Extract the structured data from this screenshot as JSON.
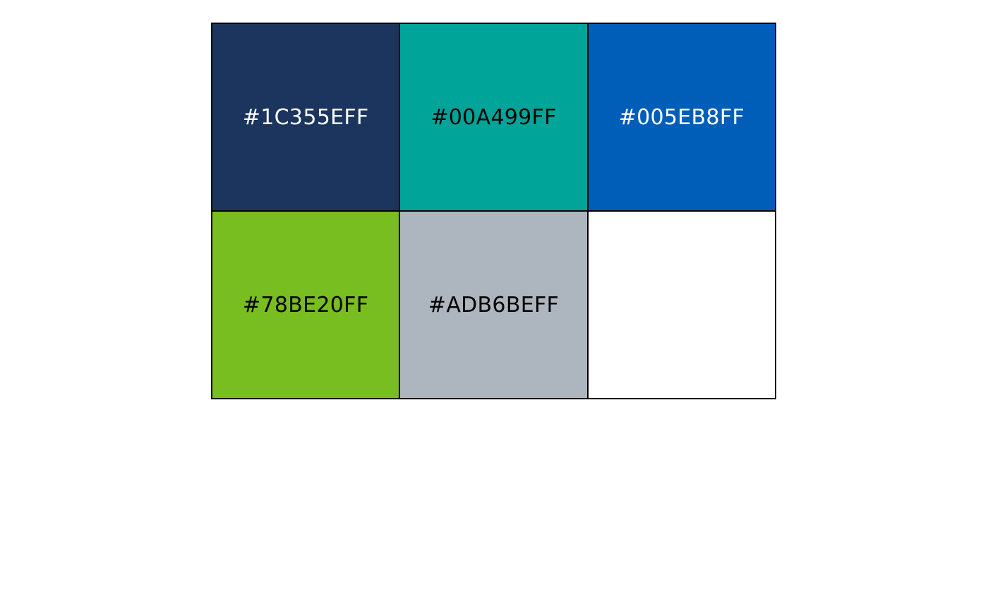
{
  "palette": {
    "swatches": [
      {
        "label": "#1C355EFF",
        "color": "#1C355E",
        "text_color": "#FFFFFF"
      },
      {
        "label": "#00A499FF",
        "color": "#00A499",
        "text_color": "#000000"
      },
      {
        "label": "#005EB8FF",
        "color": "#005EB8",
        "text_color": "#FFFFFF"
      },
      {
        "label": "#78BE20FF",
        "color": "#78BE20",
        "text_color": "#000000"
      },
      {
        "label": "#ADB6BEFF",
        "color": "#ADB6BE",
        "text_color": "#000000"
      },
      {
        "label": "",
        "color": "#FFFFFF",
        "text_color": "#000000"
      }
    ]
  }
}
